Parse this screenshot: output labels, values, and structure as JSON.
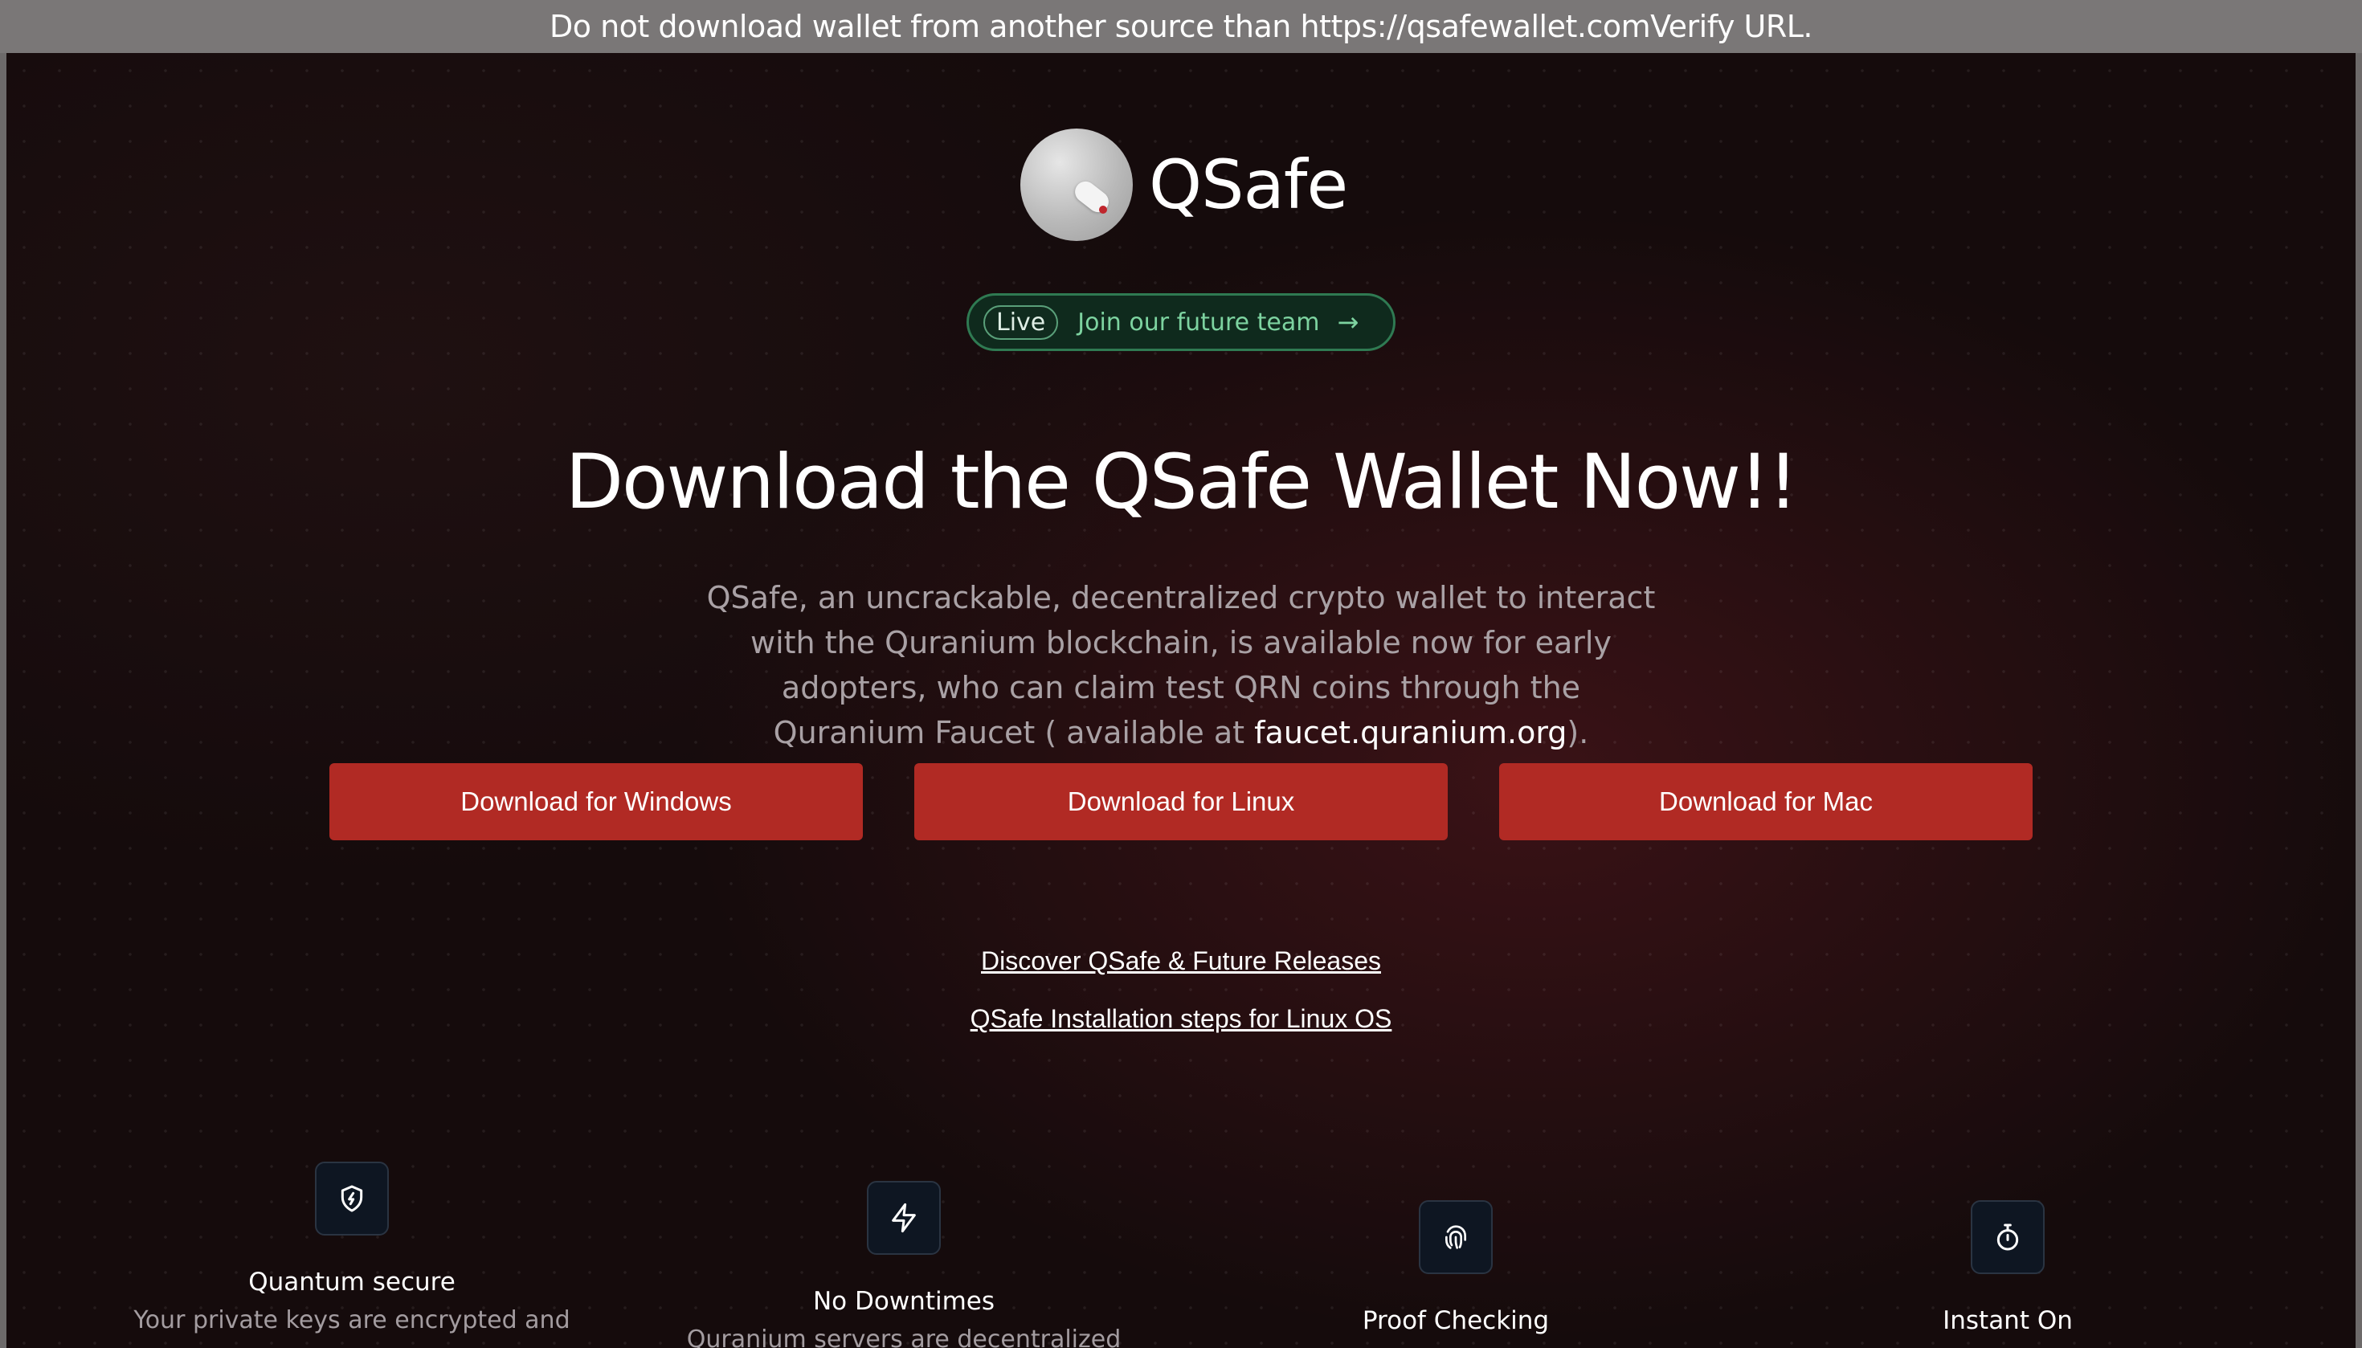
{
  "banner": {
    "text": "Do not download wallet from another source than https://qsafewallet.comVerify URL."
  },
  "logo": {
    "name": "QSafe"
  },
  "pill": {
    "badge": "Live",
    "text": "Join our future team",
    "arrow_icon": "arrow-right-icon"
  },
  "hero": {
    "headline": "Download the QSafe Wallet Now!!",
    "description_line1": "QSafe, an uncrackable, decentralized crypto wallet to interact",
    "description_line2": "with the Quranium blockchain, is available now for early",
    "description_line3": "adopters, who can claim test QRN coins through the",
    "description_line4_prefix": "Quranium Faucet ( available at ",
    "description_link": "faucet.quranium.org",
    "description_line4_suffix": ")."
  },
  "downloads": {
    "windows": "Download for Windows",
    "linux": "Download for Linux",
    "mac": "Download for Mac"
  },
  "links": {
    "discover": "Discover QSafe & Future Releases",
    "install_linux": "QSafe Installation steps for Linux OS"
  },
  "features": [
    {
      "icon": "shield-bolt-icon",
      "title": "Quantum secure",
      "desc": "Your private keys are encrypted and"
    },
    {
      "icon": "lightning-icon",
      "title": "No Downtimes",
      "desc": "Quranium servers are decentralized"
    },
    {
      "icon": "fingerprint-icon",
      "title": "Proof Checking",
      "desc": ""
    },
    {
      "icon": "stopwatch-icon",
      "title": "Instant On",
      "desc": ""
    }
  ],
  "colors": {
    "accent": "#b12a24",
    "pill_border": "#2f7a52",
    "pill_text": "#7dd3a0",
    "background": "#150b0c"
  }
}
